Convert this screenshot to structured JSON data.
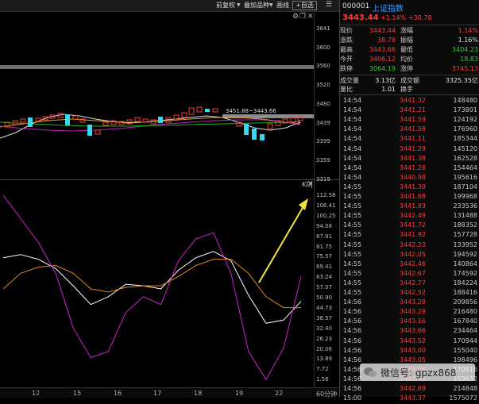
{
  "toolbar": {
    "fuquan": "前复权",
    "overlay": "叠加品种",
    "draw": "画线",
    "self_select": "+自选"
  },
  "price_axis": [
    "3641",
    "3600",
    "3560",
    "3520",
    "3480",
    "3439",
    "3399",
    "3359",
    "3319"
  ],
  "price_annotation": "3451.88~3443.66",
  "kdj": {
    "label": "KDJ",
    "axis": [
      "112.58",
      "106.41",
      "100.25",
      "94.08",
      "87.91",
      "81.75",
      "75.57",
      "69.41",
      "63.24",
      "57.07",
      "50.90",
      "44.73",
      "38.57",
      "32.40",
      "26.23",
      "20.06",
      "13.89",
      "7.72",
      "1.56"
    ],
    "k": [
      80,
      82,
      79,
      73,
      62,
      50,
      55,
      63,
      62,
      60,
      72,
      80,
      84,
      78,
      56,
      38,
      40,
      52
    ],
    "d": [
      60,
      70,
      74,
      75,
      70,
      60,
      58,
      61,
      62,
      62,
      68,
      75,
      79,
      79,
      70,
      55,
      48,
      48
    ],
    "j": [
      120,
      105,
      90,
      70,
      35,
      16,
      20,
      45,
      55,
      50,
      78,
      92,
      96,
      70,
      20,
      2,
      22,
      68
    ]
  },
  "date_axis": [
    "12",
    "15",
    "16",
    "17",
    "18",
    "19",
    "22"
  ],
  "date_unit": "60分钟",
  "quote": {
    "code": "000001",
    "name": "上证指数",
    "price": "3443.44",
    "pct": "+1.14%",
    "chg": "+38.78",
    "rows": [
      {
        "l1": "现价",
        "v1": "3443.44",
        "c1": "red",
        "l2": "涨幅",
        "v2": "1.14%",
        "c2": "red"
      },
      {
        "l1": "涨跌",
        "v1": "38.78",
        "c1": "red",
        "l2": "振幅",
        "v2": "1.16%",
        "c2": "white"
      },
      {
        "l1": "最高",
        "v1": "3443.66",
        "c1": "red",
        "l2": "最低",
        "v2": "3404.23",
        "c2": "green"
      },
      {
        "l1": "今开",
        "v1": "3406.12",
        "c1": "red",
        "l2": "均价",
        "v2": "18.83",
        "c2": "green"
      },
      {
        "l1": "跌停",
        "v1": "3064.19",
        "c1": "green",
        "l2": "涨停",
        "v2": "3745.13",
        "c2": "red"
      }
    ],
    "vol_label": "成交量",
    "vol": "3.13亿",
    "amt_label": "成交额",
    "amt": "3325.35亿",
    "ratio_label": "量比",
    "ratio": "1.01",
    "turnover_label": "换手",
    "turnover": ""
  },
  "ticks": [
    [
      "14:54",
      "3441.32",
      "148480"
    ],
    [
      "14:54",
      "3441.21",
      "173801"
    ],
    [
      "14:54",
      "3441.59",
      "124192"
    ],
    [
      "14:54",
      "3441.58",
      "176960"
    ],
    [
      "14:54",
      "3441.11",
      "185344"
    ],
    [
      "14:54",
      "3441.29",
      "145120"
    ],
    [
      "14:54",
      "3441.38",
      "162528"
    ],
    [
      "14:54",
      "3441.26",
      "154464"
    ],
    [
      "14:54",
      "3440.98",
      "195616"
    ],
    [
      "14:55",
      "3441.30",
      "187104"
    ],
    [
      "14:55",
      "3441.68",
      "199968"
    ],
    [
      "14:55",
      "3441.93",
      "233536"
    ],
    [
      "14:55",
      "3442.49",
      "131488"
    ],
    [
      "14:55",
      "3441.72",
      "188352"
    ],
    [
      "14:55",
      "3441.92",
      "157728"
    ],
    [
      "14:55",
      "3442.23",
      "133952"
    ],
    [
      "14:55",
      "3442.05",
      "194592"
    ],
    [
      "14:55",
      "3442.46",
      "140864"
    ],
    [
      "14:55",
      "3442.67",
      "174592"
    ],
    [
      "14:55",
      "3442.77",
      "184224"
    ],
    [
      "14:55",
      "3442.52",
      "188416"
    ],
    [
      "14:56",
      "3443.28",
      "209856"
    ],
    [
      "14:56",
      "3443.29",
      "216480"
    ],
    [
      "14:56",
      "3443.16",
      "167840"
    ],
    [
      "14:56",
      "3443.66",
      "234464"
    ],
    [
      "14:56",
      "3443.52",
      "170944"
    ],
    [
      "14:56",
      "3443.00",
      "155040"
    ],
    [
      "14:56",
      "3443.05",
      "198496"
    ],
    [
      "14:56",
      "3443.06",
      "170816"
    ],
    [
      "14:56",
      "3442.76",
      "153632"
    ],
    [
      "14:56",
      "3442.69",
      "214848"
    ],
    [
      "15:00",
      "3443.37",
      "1575072"
    ]
  ],
  "watermark": "微信号: gpzx868"
}
